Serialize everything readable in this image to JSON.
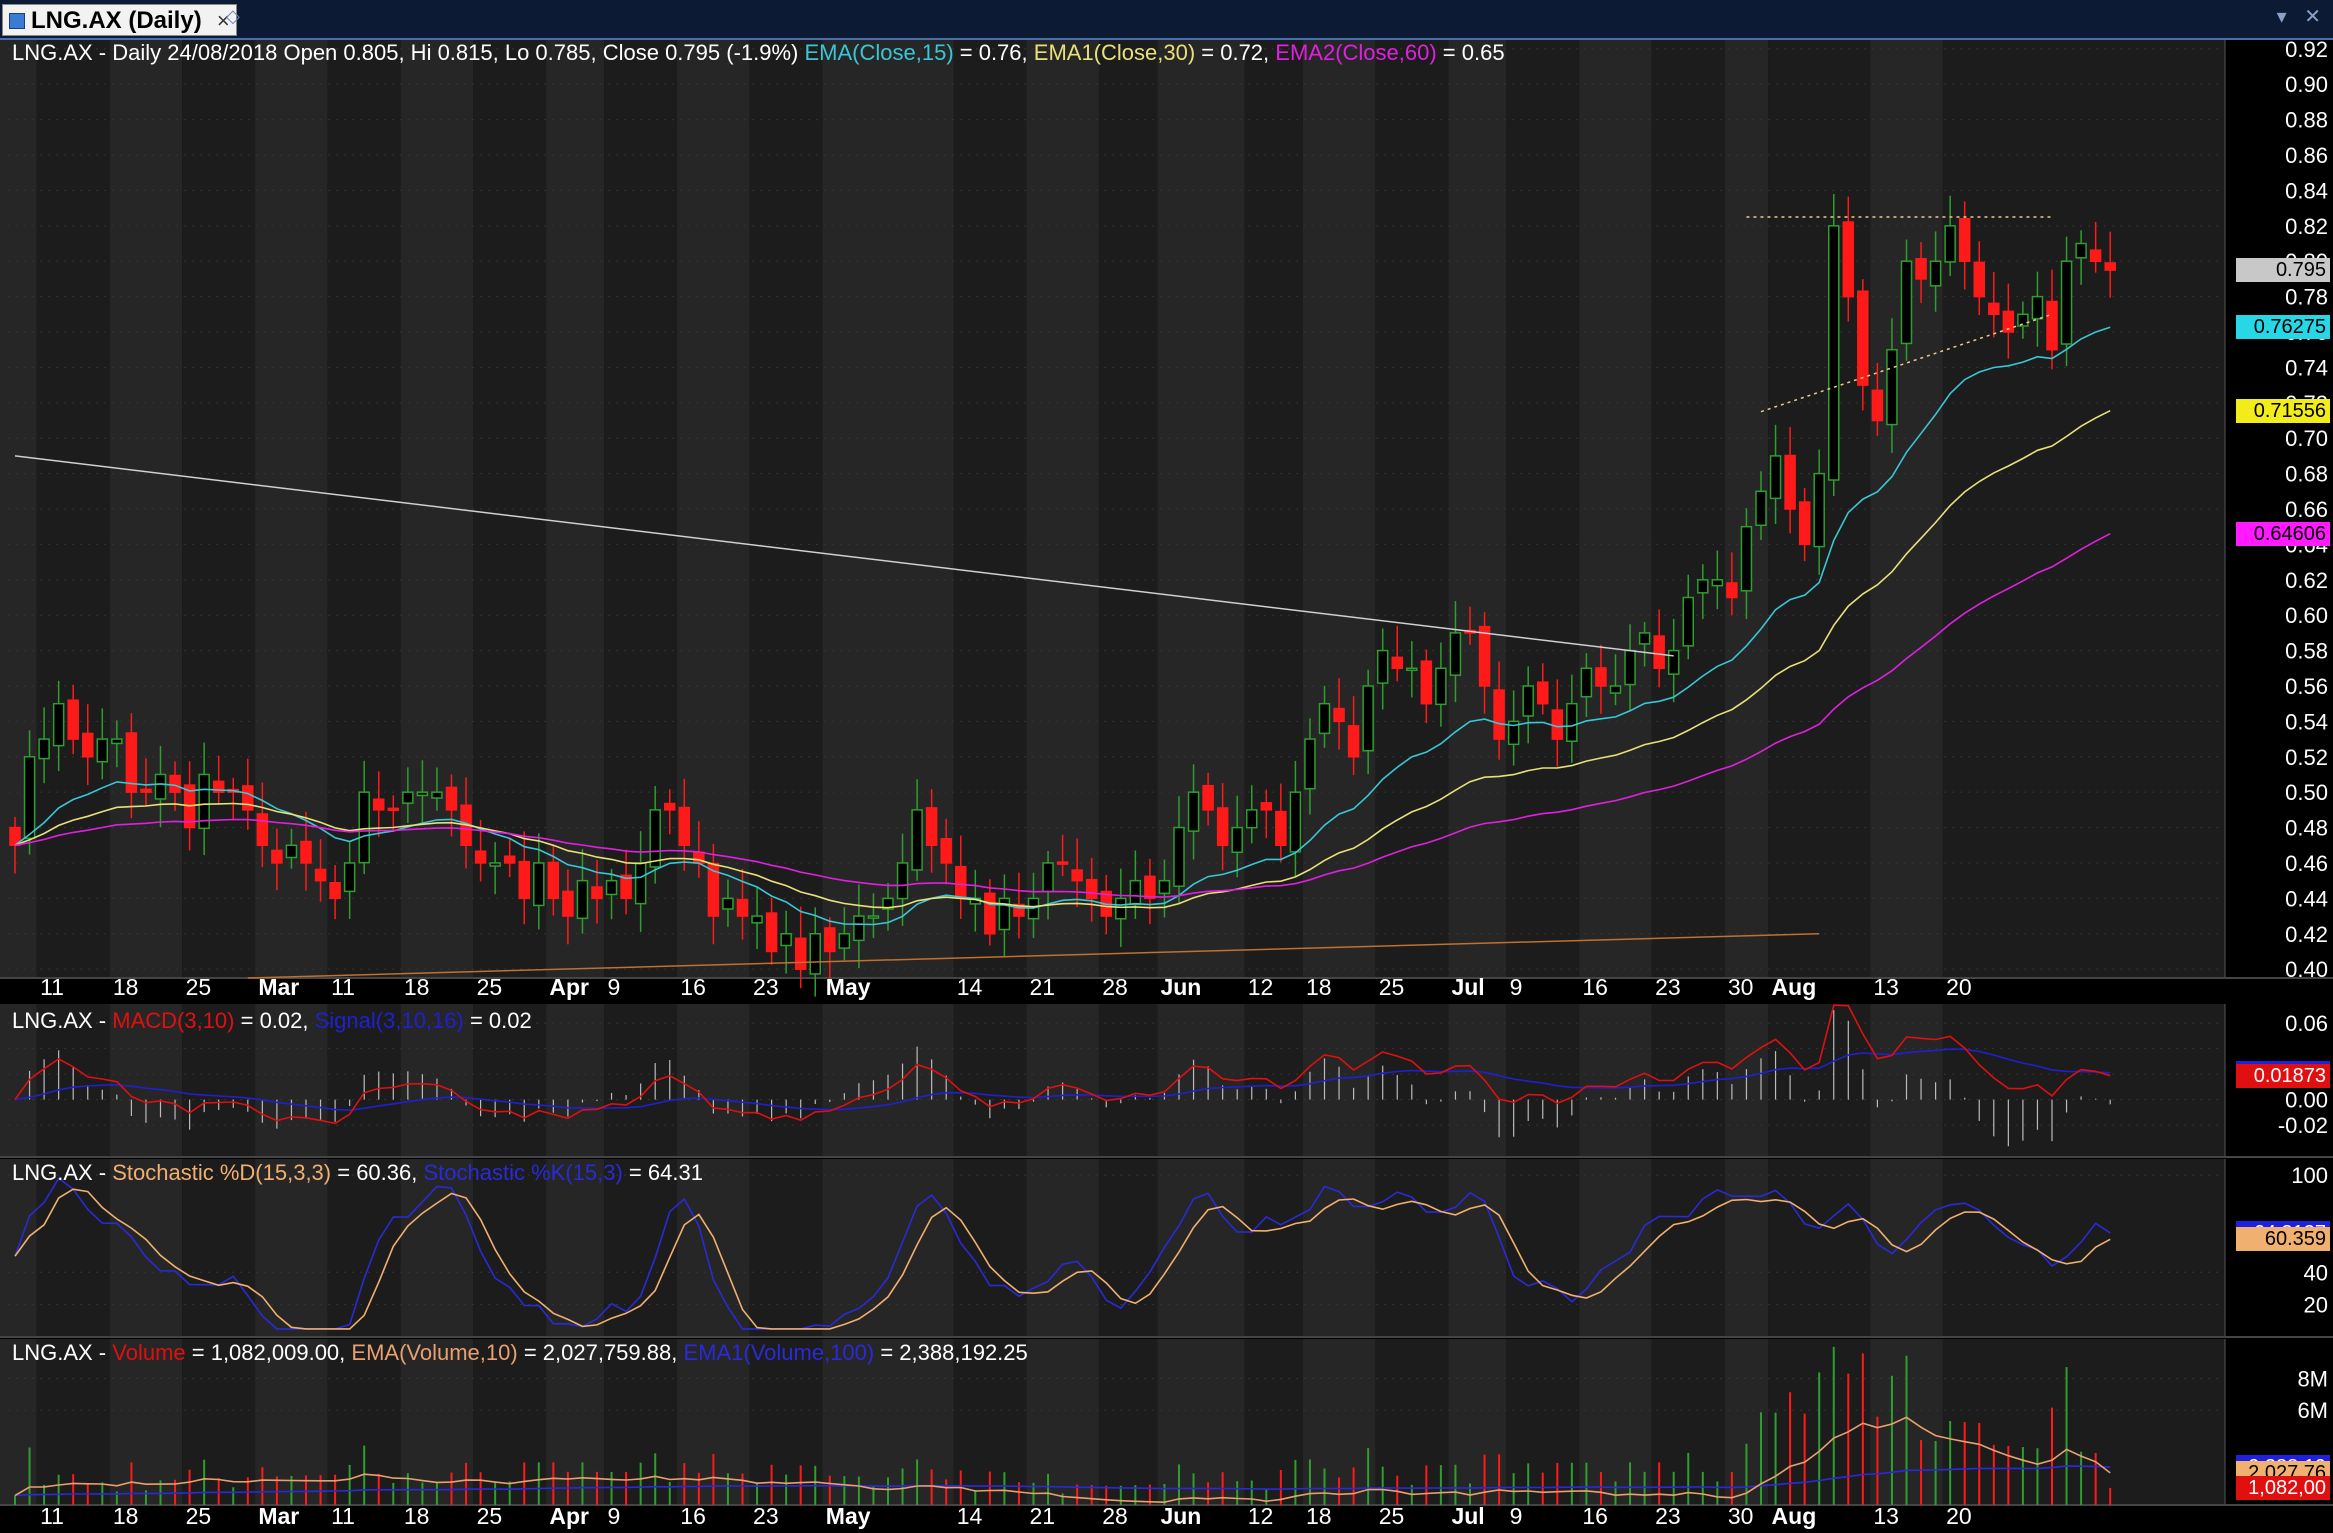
{
  "window": {
    "tab_label": "LNG.AX (Daily)",
    "tab_close": "×",
    "tab_pin": "◇",
    "win_controls": "▾ ✕"
  },
  "colors": {
    "background": "#000000",
    "band_dark": "#1c1c1c",
    "band_light": "#262626",
    "grid": "#343434",
    "up_candle": "#2e9e2e",
    "down_candle": "#ff1a1a",
    "ema15": "#39c7d6",
    "ema30": "#e8e07a",
    "ema60": "#e020e0",
    "macd": "#e01010",
    "signal": "#2020d0",
    "stoch_d": "#f0b070",
    "stoch_k": "#2a2ad8",
    "volume_ema10": "#e8a070",
    "volume_ema100": "#2a2ad8",
    "white_trendline": "#d0d0d0",
    "orange_trendline": "#c07030"
  },
  "legends": {
    "price": [
      {
        "text": "LNG.AX - Daily 24/08/2018 Open 0.805, Hi 0.815, Lo 0.785, Close 0.795 (-1.9%) ",
        "color": "#ffffff"
      },
      {
        "text": "EMA(Close,15)",
        "color": "#39c7d6"
      },
      {
        "text": " = 0.76, ",
        "color": "#ffffff"
      },
      {
        "text": "EMA1(Close,30)",
        "color": "#e8e07a"
      },
      {
        "text": " = 0.72, ",
        "color": "#ffffff"
      },
      {
        "text": "EMA2(Close,60)",
        "color": "#e020e0"
      },
      {
        "text": " = 0.65",
        "color": "#ffffff"
      }
    ],
    "macd": [
      {
        "text": "LNG.AX - ",
        "color": "#ffffff"
      },
      {
        "text": "MACD(3,10)",
        "color": "#e01010"
      },
      {
        "text": " = 0.02, ",
        "color": "#ffffff"
      },
      {
        "text": "Signal(3,10,16)",
        "color": "#2020d0"
      },
      {
        "text": " = 0.02",
        "color": "#ffffff"
      }
    ],
    "stoch": [
      {
        "text": "LNG.AX - ",
        "color": "#ffffff"
      },
      {
        "text": "Stochastic %D(15,3,3)",
        "color": "#f0b070"
      },
      {
        "text": " = 60.36, ",
        "color": "#ffffff"
      },
      {
        "text": "Stochastic %K(15,3)",
        "color": "#2a2ad8"
      },
      {
        "text": " = 64.31",
        "color": "#ffffff"
      }
    ],
    "volume": [
      {
        "text": "LNG.AX - ",
        "color": "#ffffff"
      },
      {
        "text": "Volume",
        "color": "#e01010"
      },
      {
        "text": " = 1,082,009.00, ",
        "color": "#ffffff"
      },
      {
        "text": "EMA(Volume,10)",
        "color": "#e8a070"
      },
      {
        "text": " = 2,027,759.88, ",
        "color": "#ffffff"
      },
      {
        "text": "EMA1(Volume,100)",
        "color": "#2a2ad8"
      },
      {
        "text": " = 2,388,192.25",
        "color": "#ffffff"
      }
    ]
  },
  "chart_data": {
    "type": "candlestick",
    "symbol": "LNG.AX",
    "interval": "Daily",
    "date_labels": [
      {
        "day": 2,
        "label": "11"
      },
      {
        "day": 7,
        "label": "18"
      },
      {
        "day": 12,
        "label": "25"
      },
      {
        "day": 17,
        "label": "Mar"
      },
      {
        "day": 22,
        "label": "11"
      },
      {
        "day": 27,
        "label": "18"
      },
      {
        "day": 32,
        "label": "25"
      },
      {
        "day": 37,
        "label": "Apr"
      },
      {
        "day": 41,
        "label": "9"
      },
      {
        "day": 46,
        "label": "16"
      },
      {
        "day": 51,
        "label": "23"
      },
      {
        "day": 56,
        "label": "May"
      },
      {
        "day": 65,
        "label": "14"
      },
      {
        "day": 70,
        "label": "21"
      },
      {
        "day": 75,
        "label": "28"
      },
      {
        "day": 79,
        "label": "Jun"
      },
      {
        "day": 85,
        "label": "12"
      },
      {
        "day": 89,
        "label": "18"
      },
      {
        "day": 94,
        "label": "25"
      },
      {
        "day": 99,
        "label": "Jul"
      },
      {
        "day": 103,
        "label": "9"
      },
      {
        "day": 108,
        "label": "16"
      },
      {
        "day": 113,
        "label": "23"
      },
      {
        "day": 118,
        "label": "30"
      },
      {
        "day": 121,
        "label": "Aug"
      },
      {
        "day": 128,
        "label": "13"
      },
      {
        "day": 133,
        "label": "20"
      }
    ],
    "price_axis": {
      "ylim": [
        0.395,
        0.925
      ],
      "ticks": [
        0.4,
        0.42,
        0.44,
        0.46,
        0.48,
        0.5,
        0.52,
        0.54,
        0.56,
        0.58,
        0.6,
        0.62,
        0.64,
        0.66,
        0.68,
        0.7,
        0.72,
        0.74,
        0.76,
        0.78,
        0.8,
        0.82,
        0.84,
        0.86,
        0.88,
        0.9,
        0.92
      ],
      "tick_labels": [
        "0.40",
        "0.42",
        "0.44",
        "0.46",
        "0.48",
        "0.50",
        "0.52",
        "0.54",
        "0.56",
        "0.58",
        "0.60",
        "0.62",
        "0.64",
        "0.66",
        "0.68",
        "0.70",
        "0.72",
        "0.74",
        "0.76",
        "0.78",
        "0.80",
        "0.82",
        "0.84",
        "0.86",
        "0.88",
        "0.90",
        "0.92"
      ]
    },
    "close": [
      0.47,
      0.52,
      0.53,
      0.55,
      0.53,
      0.52,
      0.53,
      0.53,
      0.5,
      0.5,
      0.51,
      0.5,
      0.48,
      0.51,
      0.5,
      0.5,
      0.49,
      0.47,
      0.46,
      0.47,
      0.46,
      0.45,
      0.44,
      0.46,
      0.5,
      0.49,
      0.49,
      0.5,
      0.5,
      0.5,
      0.49,
      0.47,
      0.46,
      0.46,
      0.46,
      0.44,
      0.46,
      0.44,
      0.43,
      0.45,
      0.44,
      0.45,
      0.44,
      0.46,
      0.49,
      0.49,
      0.47,
      0.46,
      0.43,
      0.44,
      0.43,
      0.43,
      0.41,
      0.42,
      0.4,
      0.42,
      0.41,
      0.42,
      0.43,
      0.43,
      0.44,
      0.46,
      0.49,
      0.47,
      0.46,
      0.44,
      0.44,
      0.42,
      0.44,
      0.43,
      0.44,
      0.46,
      0.46,
      0.45,
      0.44,
      0.43,
      0.44,
      0.45,
      0.44,
      0.45,
      0.48,
      0.5,
      0.49,
      0.47,
      0.48,
      0.49,
      0.49,
      0.47,
      0.5,
      0.53,
      0.55,
      0.54,
      0.52,
      0.56,
      0.58,
      0.57,
      0.57,
      0.55,
      0.57,
      0.59,
      0.59,
      0.56,
      0.53,
      0.54,
      0.56,
      0.55,
      0.53,
      0.55,
      0.57,
      0.56,
      0.56,
      0.58,
      0.59,
      0.57,
      0.58,
      0.61,
      0.62,
      0.62,
      0.61,
      0.65,
      0.67,
      0.69,
      0.66,
      0.64,
      0.68,
      0.82,
      0.78,
      0.73,
      0.71,
      0.75,
      0.8,
      0.79,
      0.8,
      0.82,
      0.8,
      0.78,
      0.77,
      0.76,
      0.77,
      0.78,
      0.75,
      0.8,
      0.81,
      0.8,
      0.795
    ],
    "ema15_end": 0.76275,
    "ema30_end": 0.71556,
    "ema60_end": 0.64606,
    "last_price": 0.795,
    "price_tags": [
      {
        "label": "0.795",
        "value": 0.795,
        "bg": "#c8c8c8"
      },
      {
        "label": "0.76275",
        "value": 0.76275,
        "bg": "#27d7e6"
      },
      {
        "label": "0.71556",
        "value": 0.71556,
        "bg": "#f2ec1a"
      },
      {
        "label": "0.64606",
        "value": 0.64606,
        "bg": "#ff1aff"
      }
    ],
    "resistance_line": {
      "from_day": 119,
      "to_day": 140,
      "value": 0.825
    },
    "uptrend_support": {
      "from_day": 120,
      "from_value": 0.715,
      "to_day": 140,
      "to_value": 0.77
    },
    "downtrend_line": {
      "from_day": 0,
      "from_value": 0.69,
      "to_day": 114,
      "to_value": 0.577
    },
    "long_support": {
      "from_day": 16,
      "from_value": 0.395,
      "to_day": 124,
      "to_value": 0.42
    },
    "macd": {
      "ylim": [
        -0.045,
        0.075
      ],
      "ticks": [
        0.06,
        0.04,
        0.02,
        0.0,
        -0.02
      ],
      "tick_labels": [
        "0.06",
        "",
        "",
        "0.00",
        "-0.02"
      ],
      "macd_end": 0.01873,
      "signal_end": 0.02104,
      "tags": [
        {
          "label": "0.02104",
          "value": 0.02104,
          "bg": "#2020e0",
          "fg": "#ffffff"
        },
        {
          "label": "0.01873",
          "value": 0.01873,
          "bg": "#e01010",
          "fg": "#ffffff"
        }
      ]
    },
    "stochastic": {
      "ylim": [
        0,
        110
      ],
      "ticks": [
        100,
        40,
        20
      ],
      "tick_labels": [
        "100",
        "40",
        "20"
      ],
      "d_end": 60.359,
      "k_end": 64.3137,
      "tags": [
        {
          "label": "64.3137",
          "value": 64.3137,
          "bg": "#2020e0",
          "fg": "#ffffff"
        },
        {
          "label": "60.359",
          "value": 60.359,
          "bg": "#f0b070",
          "fg": "#000000"
        }
      ]
    },
    "volume": {
      "ylim": [
        0,
        10500000
      ],
      "ticks": [
        8000000,
        6000000
      ],
      "tick_labels": [
        "8M",
        "6M"
      ],
      "last_volume": 1082009.0,
      "ema10_end": 2027759.88,
      "ema100_end": 2388192.25,
      "tags": [
        {
          "label": "2,388,19",
          "value": 2388192.25,
          "bg": "#2020e0",
          "fg": "#ffffff"
        },
        {
          "label": "2,027,76",
          "value": 2027759.88,
          "bg": "#f0b070",
          "fg": "#000000"
        },
        {
          "label": "1,082,00",
          "value": 1082009.0,
          "bg": "#e01010",
          "fg": "#ffffff"
        }
      ]
    }
  }
}
